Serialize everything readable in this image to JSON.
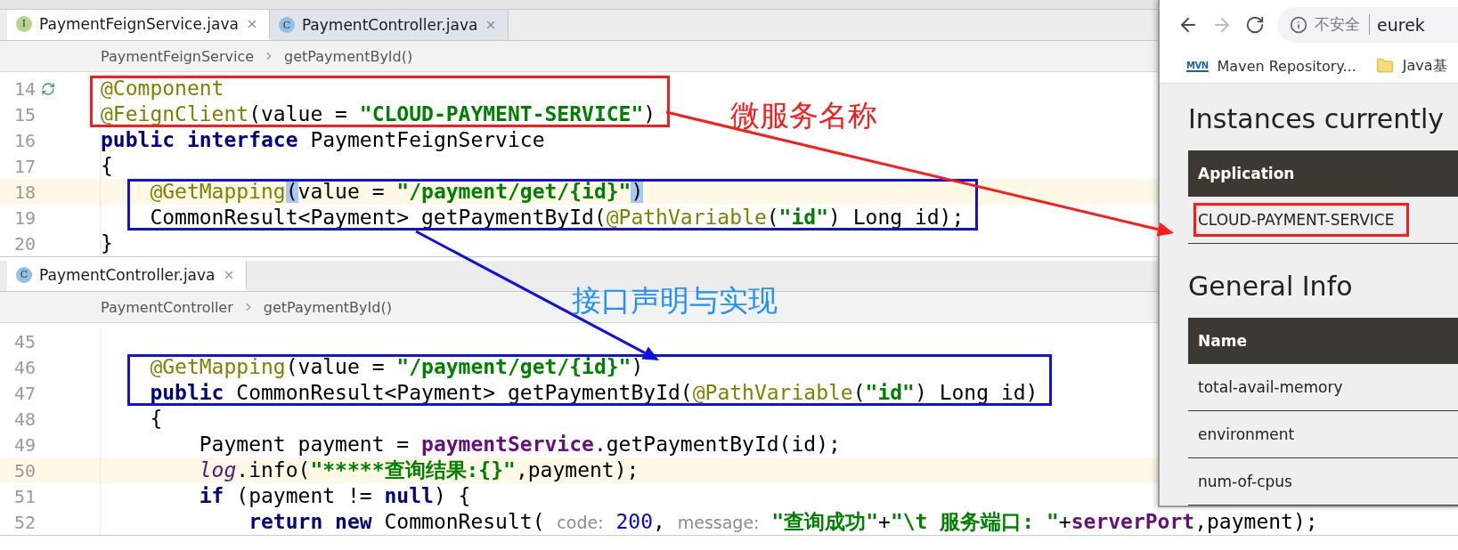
{
  "editors": [
    {
      "tabs": [
        {
          "label": "PaymentFeignService.java",
          "icon_letter": "I",
          "kind": "interface",
          "selected": true
        },
        {
          "label": "PaymentController.java",
          "icon_letter": "C",
          "kind": "class",
          "selected": false
        }
      ],
      "breadcrumb": [
        "PaymentFeignService",
        "getPaymentById()"
      ],
      "blocks": [
        {
          "kind": "service",
          "lines": [
            {
              "number": "14",
              "highlighted": false,
              "kind": "implemented",
              "tokens": [
                {
                  "kind": "annotation",
                  "text": "@Component"
                }
              ]
            },
            {
              "number": "15",
              "highlighted": false,
              "kind": "plain",
              "tokens": [
                {
                  "kind": "annotation",
                  "text": "@FeignClient"
                },
                {
                  "kind": "plain",
                  "text": "(value = "
                },
                {
                  "kind": "string",
                  "text": "\"CLOUD-PAYMENT-SERVICE\""
                },
                {
                  "kind": "plain",
                  "text": ")"
                }
              ]
            }
          ]
        },
        {
          "kind": "none",
          "lines": [
            {
              "number": "16",
              "highlighted": false,
              "kind": "plain",
              "tokens": [
                {
                  "kind": "keyword",
                  "text": "public interface"
                },
                {
                  "kind": "plain",
                  "text": " PaymentFeignService"
                }
              ]
            },
            {
              "number": "17",
              "highlighted": false,
              "kind": "plain",
              "tokens": [
                {
                  "kind": "plain",
                  "text": "{"
                }
              ]
            }
          ]
        },
        {
          "kind": "interface",
          "lines": [
            {
              "number": "18",
              "highlighted": true,
              "kind": "plain",
              "tokens": [
                {
                  "kind": "annotation",
                  "text": "    @GetMapping"
                },
                {
                  "kind": "match",
                  "text": "("
                },
                {
                  "kind": "plain",
                  "text": "value = "
                },
                {
                  "kind": "string",
                  "text": "\"/payment/get/{id}\""
                },
                {
                  "kind": "match",
                  "text": ")"
                }
              ]
            },
            {
              "number": "19",
              "highlighted": false,
              "kind": "plain",
              "tokens": [
                {
                  "kind": "plain",
                  "text": "    CommonResult<Payment> getPaymentById("
                },
                {
                  "kind": "annotation",
                  "text": "@PathVariable"
                },
                {
                  "kind": "plain",
                  "text": "("
                },
                {
                  "kind": "string",
                  "text": "\"id\""
                },
                {
                  "kind": "plain",
                  "text": ") Long id);"
                }
              ]
            }
          ]
        },
        {
          "kind": "none",
          "lines": [
            {
              "number": "20",
              "highlighted": false,
              "kind": "plain",
              "tokens": [
                {
                  "kind": "plain",
                  "text": "}"
                }
              ]
            }
          ]
        }
      ]
    },
    {
      "tabs": [
        {
          "label": "PaymentController.java",
          "icon_letter": "C",
          "kind": "class",
          "selected": true
        }
      ],
      "breadcrumb": [
        "PaymentController",
        "getPaymentById()"
      ],
      "blocks": [
        {
          "kind": "none",
          "lines": [
            {
              "number": "45",
              "highlighted": false,
              "kind": "plain"
            }
          ]
        },
        {
          "kind": "interface",
          "lines": [
            {
              "number": "46",
              "highlighted": false,
              "kind": "plain",
              "tokens": [
                {
                  "kind": "annotation",
                  "text": "    @GetMapping"
                },
                {
                  "kind": "plain",
                  "text": "(value = "
                },
                {
                  "kind": "string",
                  "text": "\"/payment/get/{id}\""
                },
                {
                  "kind": "plain",
                  "text": ")"
                }
              ]
            },
            {
              "number": "47",
              "highlighted": false,
              "kind": "plain",
              "tokens": [
                {
                  "kind": "keyword",
                  "text": "    public"
                },
                {
                  "kind": "plain",
                  "text": " CommonResult<Payment> getPaymentById("
                },
                {
                  "kind": "annotation",
                  "text": "@PathVariable"
                },
                {
                  "kind": "plain",
                  "text": "("
                },
                {
                  "kind": "string",
                  "text": "\"id\""
                },
                {
                  "kind": "plain",
                  "text": ") Long id)"
                }
              ]
            }
          ]
        },
        {
          "kind": "none",
          "lines": [
            {
              "number": "48",
              "highlighted": false,
              "kind": "plain",
              "tokens": [
                {
                  "kind": "plain",
                  "text": "    {"
                }
              ]
            },
            {
              "number": "49",
              "highlighted": false,
              "kind": "plain",
              "tokens": [
                {
                  "kind": "plain",
                  "text": "        Payment payment = "
                },
                {
                  "kind": "field",
                  "text": "paymentService"
                },
                {
                  "kind": "plain",
                  "text": ".getPaymentById(id);"
                }
              ]
            },
            {
              "number": "50",
              "highlighted": true,
              "kind": "plain",
              "tokens": [
                {
                  "kind": "static",
                  "text": "        log"
                },
                {
                  "kind": "plain",
                  "text": ".info("
                },
                {
                  "kind": "string",
                  "text": "\"*****查询结果:{}\""
                },
                {
                  "kind": "plain",
                  "text": ",payment);"
                }
              ]
            },
            {
              "number": "51",
              "highlighted": false,
              "kind": "plain",
              "tokens": [
                {
                  "kind": "keyword",
                  "text": "        if"
                },
                {
                  "kind": "plain",
                  "text": " (payment != "
                },
                {
                  "kind": "keyword",
                  "text": "null"
                },
                {
                  "kind": "plain",
                  "text": ") {"
                }
              ]
            },
            {
              "number": "52",
              "highlighted": false,
              "kind": "plain",
              "tokens": [
                {
                  "kind": "keyword",
                  "text": "            return new"
                },
                {
                  "kind": "plain",
                  "text": " CommonResult( "
                },
                {
                  "kind": "hint",
                  "text": "code:"
                },
                {
                  "kind": "number",
                  "text": " 200"
                },
                {
                  "kind": "plain",
                  "text": ", "
                },
                {
                  "kind": "hint",
                  "text": "message:"
                },
                {
                  "kind": "string",
                  "text": " \"查询成功\""
                },
                {
                  "kind": "plain",
                  "text": "+"
                },
                {
                  "kind": "string",
                  "text": "\"\\t 服务端口: \""
                },
                {
                  "kind": "plain",
                  "text": "+"
                },
                {
                  "kind": "field",
                  "text": "serverPort"
                },
                {
                  "kind": "plain",
                  "text": ",payment);"
                }
              ]
            }
          ]
        }
      ]
    }
  ],
  "browser": {
    "buttons": [
      {
        "kind": "back",
        "disabled": false
      },
      {
        "kind": "forward",
        "disabled": true
      },
      {
        "kind": "reload",
        "disabled": false
      }
    ],
    "security": "不安全",
    "url": "eurek",
    "bookmarks": [
      {
        "kind": "mvn",
        "logo_text": "MVN",
        "label": "Maven Repository..."
      },
      {
        "kind": "folder",
        "label": "Java基"
      }
    ],
    "sections": [
      {
        "title": "Instances currently",
        "header": "Application",
        "rows": [
          {
            "text": "CLOUD-PAYMENT-SERVICE",
            "framed": true
          }
        ]
      },
      {
        "title": "General Info",
        "header": "Name",
        "rows": [
          {
            "text": "total-avail-memory",
            "framed": false
          },
          {
            "text": "environment",
            "framed": false
          },
          {
            "text": "num-of-cpus",
            "framed": false
          }
        ]
      }
    ]
  },
  "annotations": [
    {
      "kind": "service",
      "text": "微服务名称"
    },
    {
      "kind": "interface",
      "text": "接口声明与实现"
    }
  ]
}
